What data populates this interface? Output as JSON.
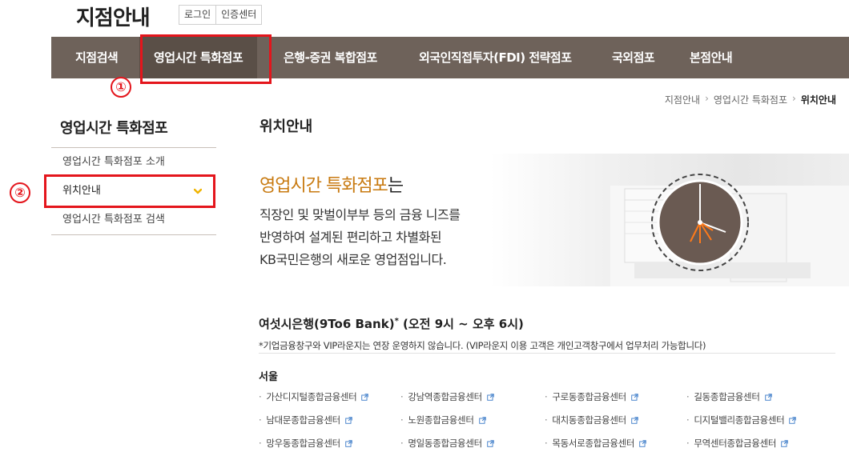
{
  "header": {
    "title": "지점안내",
    "links": [
      "로그인",
      "인증센터"
    ]
  },
  "gnb": {
    "items": [
      "지점검색",
      "영업시간 특화점포",
      "은행-증권 복합점포",
      "외국인직접투자(FDI) 전략점포",
      "국외점포",
      "본점안내"
    ],
    "active_index": 1
  },
  "annotations": {
    "marker1": "①",
    "marker2": "②",
    "color": "#e4151c"
  },
  "breadcrumb": [
    "지점안내",
    "영업시간 특화점포",
    "위치안내"
  ],
  "lnb": {
    "title": "영업시간 특화점포",
    "items": [
      "영업시간 특화점포 소개",
      "위치안내",
      "영업시간 특화점포 검색"
    ]
  },
  "content": {
    "title": "위치안내",
    "hero_highlight": "영업시간 특화점포",
    "hero_suffix": "는",
    "hero_lines": [
      "직장인 및  맞벌이부부 등의 금융 니즈를",
      "반영하여 설계된 편리하고 차별화된",
      "KB국민은행의 새로운 영업점입니다."
    ],
    "section_title": "여섯시은행(9To6 Bank)",
    "section_sup": "*",
    "section_hours": " (오전 9시 ~ 오후 6시)",
    "note": "*기업금융창구와 VIP라운지는 연장 운영하지 않습니다. (VIP라운지 이용 고객은 개인고객창구에서 업무처리 가능합니다)",
    "region": "서울",
    "branches": [
      [
        "가산디지털종합금융센터",
        "강남역종합금융센터",
        "구로동종합금융센터",
        "길동종합금융센터"
      ],
      [
        "남대문종합금융센터",
        "노원종합금융센터",
        "대치동종합금융센터",
        "디지털밸리종합금융센터"
      ],
      [
        "망우동종합금융센터",
        "명일동종합금융센터",
        "목동서로종합금융센터",
        "무역센터종합금융센터"
      ]
    ]
  },
  "colors": {
    "gnb_bg": "#6e625a",
    "accent": "#c87a10",
    "chevron": "#f0b400"
  }
}
